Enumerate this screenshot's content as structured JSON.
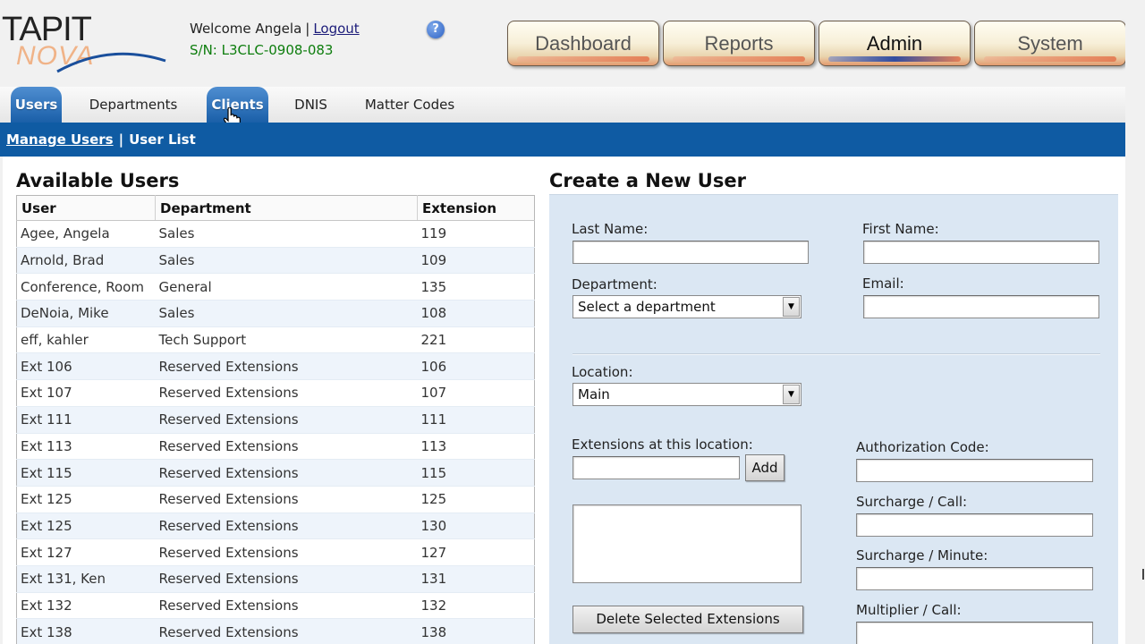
{
  "header": {
    "logo_text": "TAPIT",
    "logo_sub": "NOVA",
    "welcome_text": "Welcome Angela",
    "logout_label": "Logout",
    "serial": "S/N: L3CLC-0908-083",
    "help_icon": "?"
  },
  "main_nav": [
    {
      "label": "Dashboard",
      "active": false
    },
    {
      "label": "Reports",
      "active": false
    },
    {
      "label": "Admin",
      "active": true
    },
    {
      "label": "System",
      "active": false
    }
  ],
  "tabs": [
    {
      "label": "Users",
      "active": true
    },
    {
      "label": "Departments",
      "active": false
    },
    {
      "label": "Clients",
      "active": false
    },
    {
      "label": "DNIS",
      "active": false
    },
    {
      "label": "Matter Codes",
      "active": false
    }
  ],
  "breadcrumb": {
    "link": "Manage Users",
    "current": "User List"
  },
  "users": {
    "title": "Available Users",
    "columns": [
      "User",
      "Department",
      "Extension"
    ],
    "rows": [
      [
        "Agee, Angela",
        "Sales",
        "119"
      ],
      [
        "Arnold, Brad",
        "Sales",
        "109"
      ],
      [
        "Conference, Room",
        "General",
        "135"
      ],
      [
        "DeNoia, Mike",
        "Sales",
        "108"
      ],
      [
        "eff, kahler",
        "Tech Support",
        "221"
      ],
      [
        "Ext 106",
        "Reserved Extensions",
        "106"
      ],
      [
        "Ext 107",
        "Reserved Extensions",
        "107"
      ],
      [
        "Ext 111",
        "Reserved Extensions",
        "111"
      ],
      [
        "Ext 113",
        "Reserved Extensions",
        "113"
      ],
      [
        "Ext 115",
        "Reserved Extensions",
        "115"
      ],
      [
        "Ext 125",
        "Reserved Extensions",
        "125"
      ],
      [
        "Ext 125",
        "Reserved Extensions",
        "130"
      ],
      [
        "Ext 127",
        "Reserved Extensions",
        "127"
      ],
      [
        "Ext 131, Ken",
        "Reserved Extensions",
        "131"
      ],
      [
        "Ext 132",
        "Reserved Extensions",
        "132"
      ],
      [
        "Ext 138",
        "Reserved Extensions",
        "138"
      ]
    ]
  },
  "form": {
    "title": "Create a New User",
    "last_name_label": "Last Name:",
    "first_name_label": "First Name:",
    "department_label": "Department:",
    "department_value": "Select a department",
    "email_label": "Email:",
    "location_label": "Location:",
    "location_value": "Main",
    "extensions_label": "Extensions at this location:",
    "add_label": "Add",
    "delete_label": "Delete Selected Extensions",
    "auth_code_label": "Authorization Code:",
    "surcharge_call_label": "Surcharge / Call:",
    "surcharge_minute_label": "Surcharge / Minute:",
    "multiplier_call_label": "Multiplier / Call:"
  },
  "colors": {
    "sub_bar": "#0f5ba3",
    "tab_active": "#1a5fa8",
    "form_bg": "#dbe7f3",
    "serial_green": "#0d7d0d"
  }
}
